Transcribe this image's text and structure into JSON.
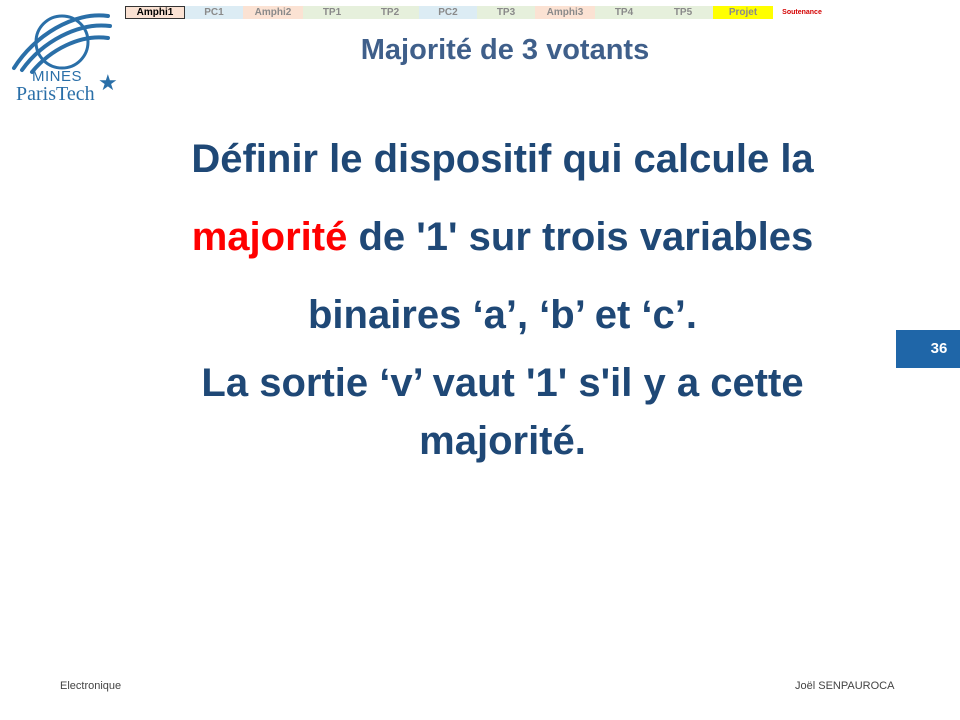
{
  "logo": {
    "line1": "MINES",
    "line2": "ParisTech",
    "star": "★"
  },
  "nav": {
    "tabs": [
      {
        "label": "Amphi1",
        "bg": "#fbe2d3",
        "active": true
      },
      {
        "label": "PC1",
        "bg": "#dcecf4",
        "active": false
      },
      {
        "label": "Amphi2",
        "bg": "#fbe2d3",
        "active": false
      },
      {
        "label": "TP1",
        "bg": "#e6f0dc",
        "active": false
      },
      {
        "label": "TP2",
        "bg": "#e6f0dc",
        "active": false
      },
      {
        "label": "PC2",
        "bg": "#dcecf4",
        "active": false
      },
      {
        "label": "TP3",
        "bg": "#e6f0dc",
        "active": false
      },
      {
        "label": "Amphi3",
        "bg": "#fbe2d3",
        "active": false
      },
      {
        "label": "TP4",
        "bg": "#e6f0dc",
        "active": false
      },
      {
        "label": "TP5",
        "bg": "#e6f0dc",
        "active": false
      },
      {
        "label": "Projet",
        "bg": "#ffff00",
        "active": false
      },
      {
        "label": "Soutenance",
        "bg": "#ffffff",
        "active": false
      }
    ]
  },
  "slide": {
    "title": "Majorité de 3 votants",
    "line1": "Définir le dispositif qui calcule la",
    "line2_highlight": "majorité",
    "line2_rest": " de '1' sur trois variables",
    "line3": "binaires ‘a’, ‘b’ et ‘c’.",
    "line4": "La sortie ‘v’ vaut '1' s'il y a cette",
    "line5": "majorité.",
    "page_number": "36"
  },
  "footer": {
    "left": "Electronique",
    "right": "Joël SENPAUROCA"
  },
  "colors": {
    "title": "#3f5f8a",
    "body": "#1f4876",
    "highlight": "#ff0000",
    "page_badge": "#1f66a8",
    "logo": "#2a6fa8"
  }
}
